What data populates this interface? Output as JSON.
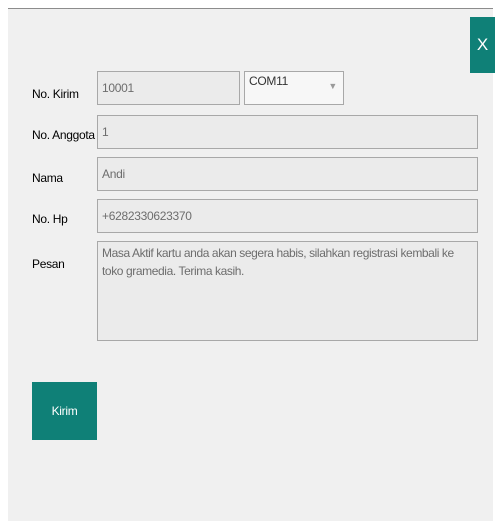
{
  "close_label": "X",
  "fields": {
    "no_kirim": {
      "label": "No. Kirim",
      "value": "10001"
    },
    "port": {
      "value": "COM11"
    },
    "no_anggota": {
      "label": "No. Anggota",
      "value": "1"
    },
    "nama": {
      "label": "Nama",
      "value": "Andi"
    },
    "no_hp": {
      "label": "No. Hp",
      "value": "+6282330623370"
    },
    "pesan": {
      "label": "Pesan",
      "value": "Masa Aktif kartu anda akan segera habis, silahkan registrasi kembali ke toko gramedia. Terima kasih."
    }
  },
  "send_label": "Kirim",
  "colors": {
    "accent": "#0f8077",
    "window_bg": "#f0f0f0",
    "field_bg": "#ebebeb"
  }
}
